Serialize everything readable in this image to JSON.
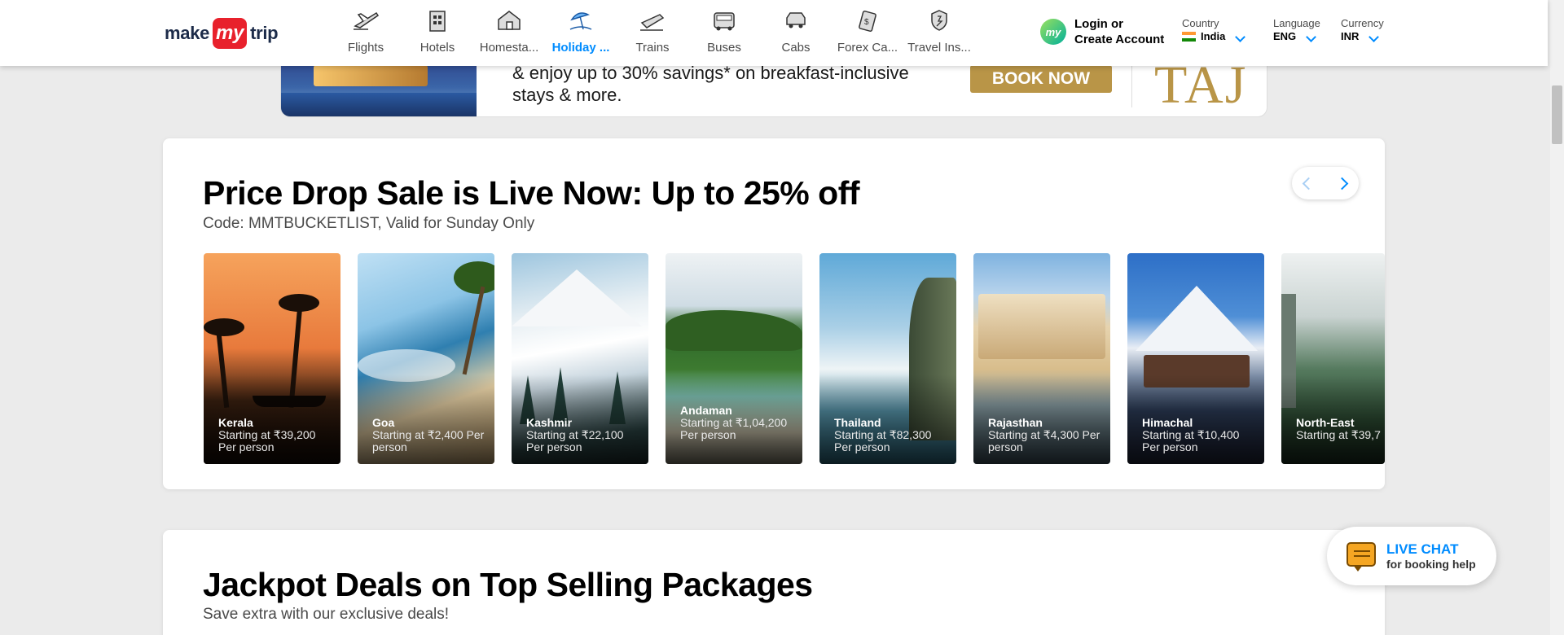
{
  "header": {
    "logo": {
      "left": "make",
      "badge": "my",
      "right": "trip"
    },
    "nav": [
      {
        "label": "Flights",
        "icon": "flight-icon"
      },
      {
        "label": "Hotels",
        "icon": "hotel-icon"
      },
      {
        "label": "Homesta...",
        "icon": "homestay-icon"
      },
      {
        "label": "Holiday ...",
        "icon": "holiday-icon",
        "active": true
      },
      {
        "label": "Trains",
        "icon": "train-icon"
      },
      {
        "label": "Buses",
        "icon": "bus-icon"
      },
      {
        "label": "Cabs",
        "icon": "cab-icon"
      },
      {
        "label": "Forex Ca...",
        "icon": "forex-icon"
      },
      {
        "label": "Travel Ins...",
        "icon": "insurance-icon"
      }
    ],
    "login": {
      "line1": "Login or",
      "line2": "Create Account",
      "avatar": "my"
    },
    "country": {
      "label": "Country",
      "value": "India"
    },
    "language": {
      "label": "Language",
      "value": "ENG"
    },
    "currency": {
      "label": "Currency",
      "value": "INR"
    }
  },
  "banner": {
    "text_line1": "& enjoy up to 30% savings* on breakfast-inclusive",
    "text_line2": "stays & more.",
    "cta": "BOOK NOW",
    "brand": "TAJ"
  },
  "price_drop": {
    "title": "Price Drop Sale is Live Now: Up to 25% off",
    "subtitle": "Code: MMTBUCKETLIST, Valid for Sunday Only",
    "destinations": [
      {
        "name": "Kerala",
        "price": "Starting at ₹39,200 Per person"
      },
      {
        "name": "Goa",
        "price": "Starting at ₹2,400 Per person"
      },
      {
        "name": "Kashmir",
        "price": "Starting at ₹22,100 Per person"
      },
      {
        "name": "Andaman",
        "price": "Starting at ₹1,04,200 Per person"
      },
      {
        "name": "Thailand",
        "price": "Starting at ₹82,300 Per person"
      },
      {
        "name": "Rajasthan",
        "price": "Starting at ₹4,300 Per person"
      },
      {
        "name": "Himachal",
        "price": "Starting at ₹10,400 Per person"
      },
      {
        "name": "North-East",
        "price": "Starting at ₹39,7"
      }
    ]
  },
  "jackpot": {
    "title": "Jackpot Deals on Top Selling Packages",
    "subtitle": "Save extra with our exclusive deals!"
  },
  "live_chat": {
    "title": "LIVE CHAT",
    "subtitle": "for booking help"
  },
  "colors": {
    "accent": "#008cff",
    "brand_red": "#e8212c",
    "taj_gold": "#b99547"
  }
}
